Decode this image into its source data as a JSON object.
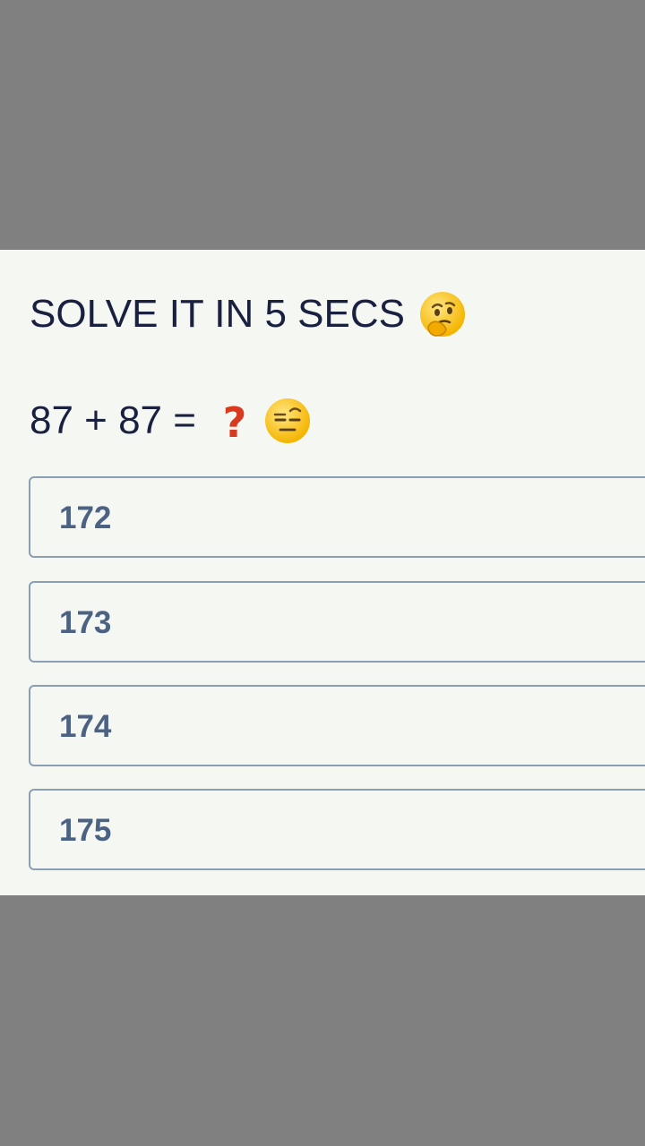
{
  "quiz": {
    "title": "SOLVE IT IN 5 SECS",
    "title_emoji": "thinking-face-icon",
    "question": "87 + 87 =",
    "question_mark": "❓",
    "question_emoji": "raised-eyebrow-face-icon",
    "options": [
      {
        "label": "172"
      },
      {
        "label": "173"
      },
      {
        "label": "174"
      },
      {
        "label": "175"
      }
    ]
  },
  "colors": {
    "background": "#808080",
    "card": "#f5f7f2",
    "text": "#1a2040",
    "option_text": "#4c6283",
    "option_border": "#8aa0b2",
    "question_mark": "#d9391c"
  }
}
